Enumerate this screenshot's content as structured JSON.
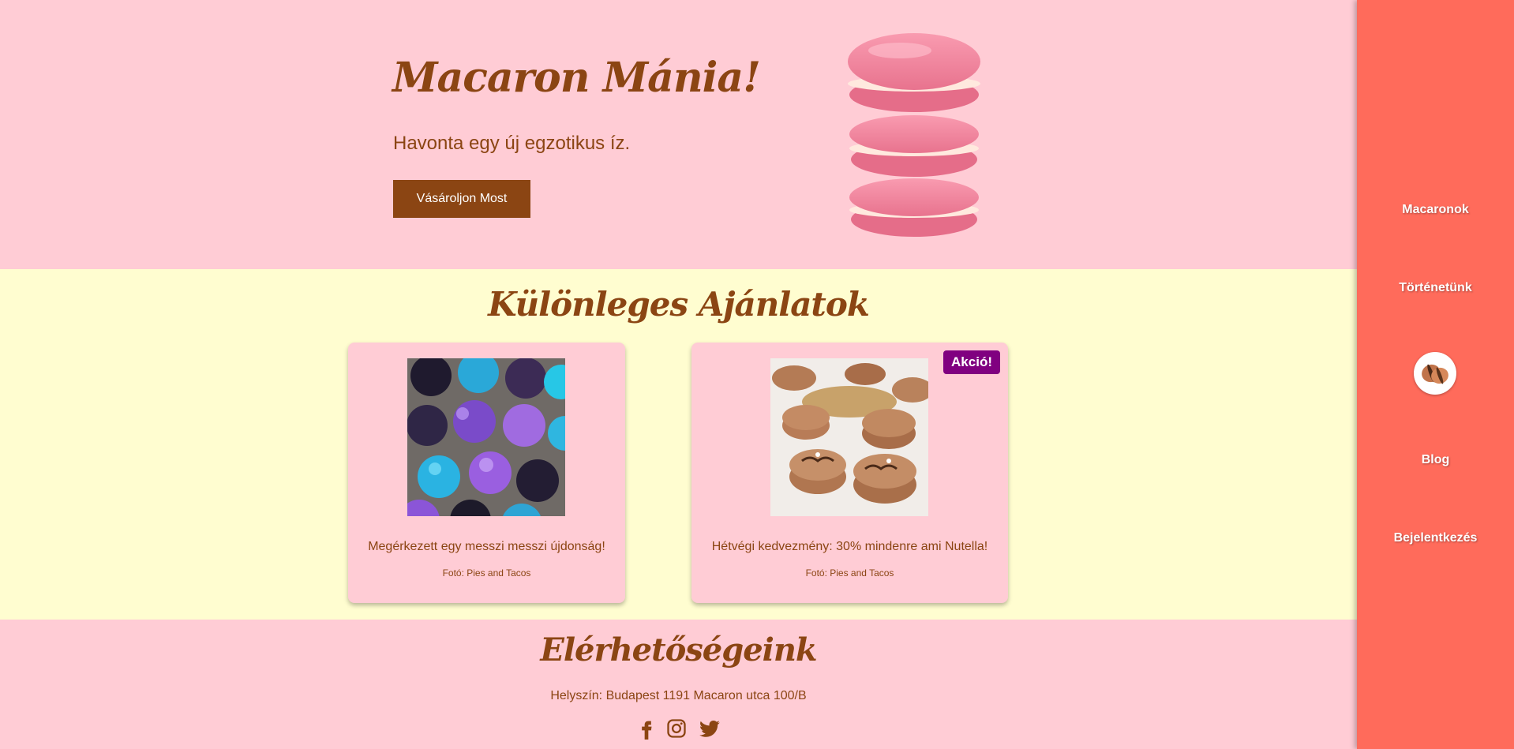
{
  "hero": {
    "title": "Macaron Mánia!",
    "subtitle": "Havonta egy új egzotikus íz.",
    "button_label": "Vásároljon Most"
  },
  "offers": {
    "title": "Különleges Ajánlatok",
    "cards": [
      {
        "text": "Megérkezett egy messzi messzi újdonság!",
        "credit": "Fotó: Pies and Tacos",
        "image": "galaxy-macarons-photo"
      },
      {
        "text": "Hétvégi kedvezmény: 30% mindenre ami Nutella!",
        "credit": "Fotó: Pies and Tacos",
        "image": "chocolate-macarons-photo",
        "badge": "Akció!"
      }
    ]
  },
  "contact": {
    "title": "Elérhetőségeink",
    "location": "Helyszín: Budapest 1191 Macaron utca 100/B",
    "socials": [
      "facebook-icon",
      "instagram-icon",
      "twitter-icon"
    ]
  },
  "sidebar": {
    "items": [
      {
        "label": "Macaronok"
      },
      {
        "label": "Történetünk"
      },
      {
        "label": "Blog"
      },
      {
        "label": "Bejelentkezés"
      }
    ],
    "logo": "macaron-logo-icon"
  },
  "colors": {
    "pink": "#ffccd5",
    "cream": "#fffdd0",
    "brown": "#8b4513",
    "sidebar": "#ff6b5b",
    "badge": "#800080"
  }
}
